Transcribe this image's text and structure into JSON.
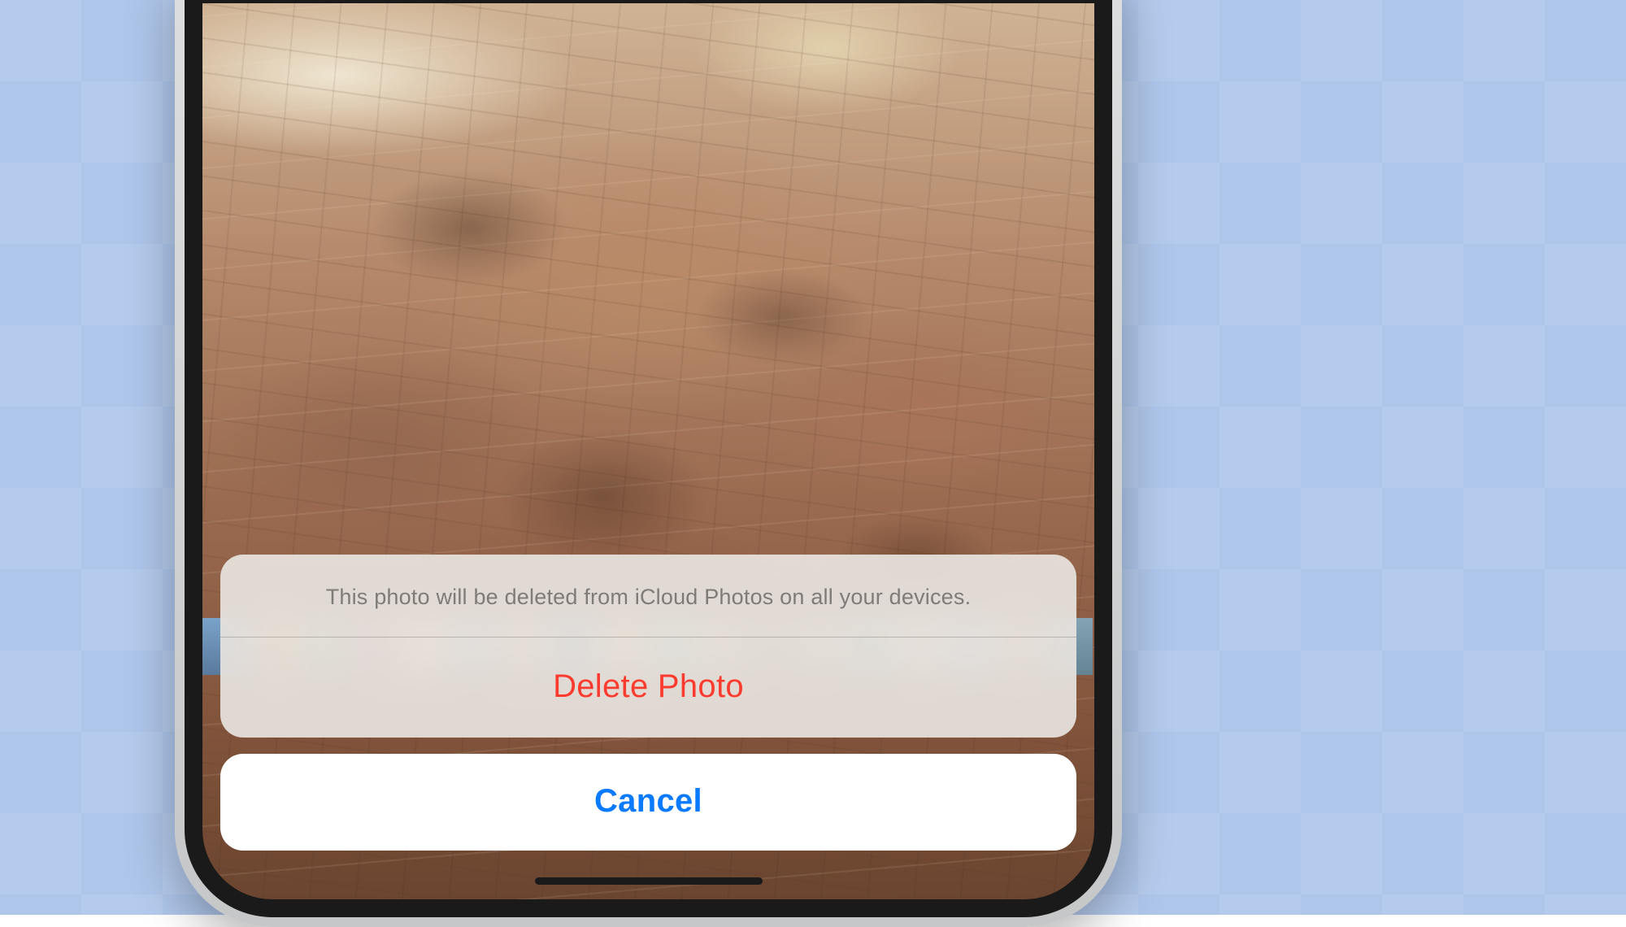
{
  "actionSheet": {
    "message": "This photo will be deleted from iCloud Photos on all your devices.",
    "destructiveLabel": "Delete Photo",
    "cancelLabel": "Cancel"
  },
  "colors": {
    "destructive": "#fc3b2f",
    "cancel": "#0a7aff",
    "sheetBackground": "rgba(232,228,224,0.92)"
  }
}
